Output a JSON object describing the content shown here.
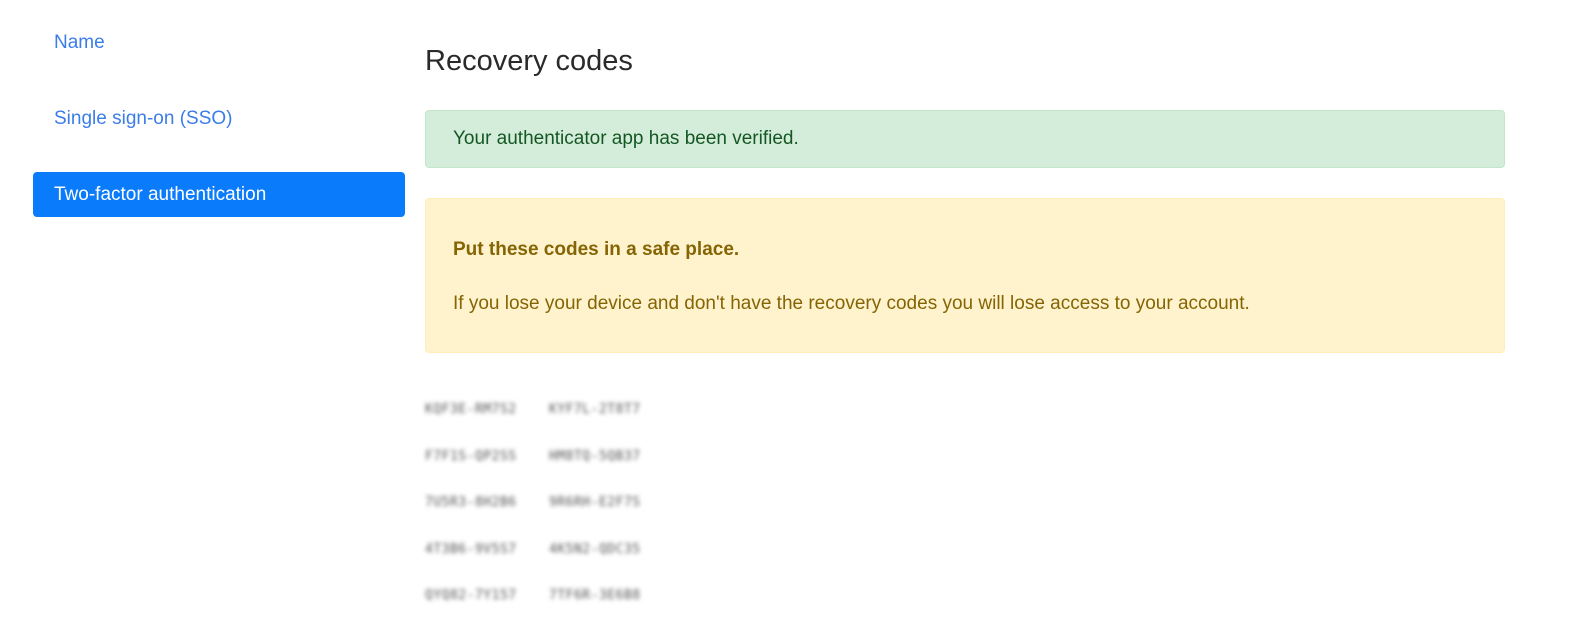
{
  "sidebar": {
    "items": [
      {
        "label": "Name",
        "active": false
      },
      {
        "label": "Single sign-on (SSO)",
        "active": false
      },
      {
        "label": "Two-factor authentication",
        "active": true
      }
    ]
  },
  "main": {
    "title": "Recovery codes",
    "success_alert": "Your authenticator app has been verified.",
    "warning_alert": {
      "heading": "Put these codes in a safe place.",
      "body": "If you lose your device and don't have the recovery codes you will lose access to your account."
    }
  },
  "codes": [
    [
      "KQF3E-RM7S2",
      "KYF7L-2T8T7"
    ],
    [
      "F7F1S-QP2SS",
      "HM8TQ-5QB37"
    ],
    [
      "7U5R3-8H2B6",
      "9R6RH-E2F7S"
    ],
    [
      "4T3B6-9V5S7",
      "4K5N2-QDC35"
    ],
    [
      "QYQ82-7Y157",
      "7TF6R-3E6B8"
    ]
  ],
  "colors": {
    "link": "#3b7de8",
    "active_bg": "#0a7bfa",
    "success_bg": "#d4edda",
    "success_text": "#155724",
    "warning_bg": "#fff3cd",
    "warning_text": "#856404"
  }
}
